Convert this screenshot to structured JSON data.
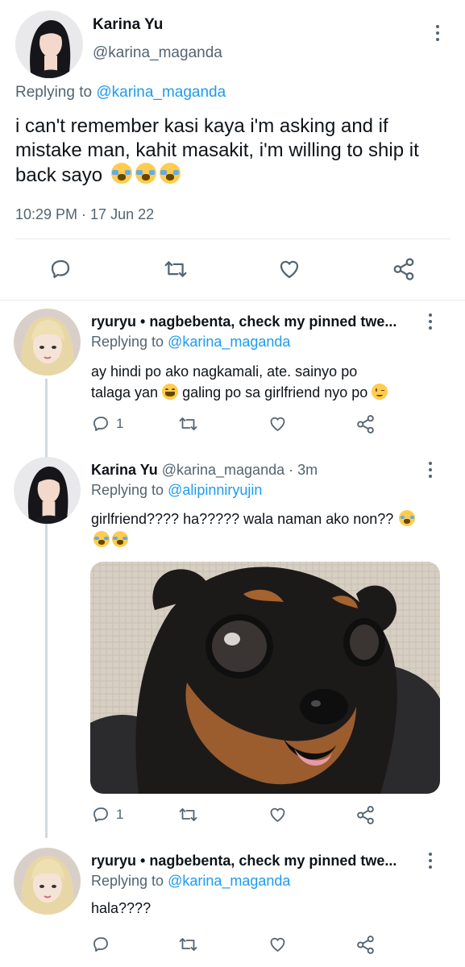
{
  "main_tweet": {
    "display_name": "Karina Yu",
    "handle": "@karina_maganda",
    "replying_prefix": "Replying to",
    "replying_handle": "@karina_maganda",
    "text": "i can't remember kasi kaya i'm asking and if mistake man, kahit masakit, i'm willing to ship it back sayo",
    "emoji": [
      "crying-face",
      "crying-face",
      "crying-face"
    ],
    "timestamp": "10:29 PM · 17 Jun 22"
  },
  "replies": [
    {
      "display_name": "ryuryu • nagbebenta, check my pinned twe...",
      "replying_prefix": "Replying to",
      "replying_handle": "@karina_maganda",
      "text_line1": "ay hindi po ako nagkamali, ate. sainyo po",
      "text_line2a": "talaga yan",
      "text_line2b": "galing po sa girlfriend nyo po",
      "reply_count": "1"
    },
    {
      "display_name": "Karina Yu",
      "handle": "@karina_maganda",
      "time": "· 3m",
      "replying_prefix": "Replying to",
      "replying_handle": "@alipinniryujin",
      "text": "girlfriend???? ha????? wala naman ako non??",
      "reply_count": "1",
      "image": "chihuahua-photo"
    },
    {
      "display_name": "ryuryu • nagbebenta, check my pinned twe...",
      "replying_prefix": "Replying to",
      "replying_handle": "@karina_maganda",
      "text": "hala????"
    }
  ],
  "colors": {
    "accent": "#1d9bf0",
    "muted": "#536471",
    "divider": "#e6ecf0",
    "text": "#0f1419"
  }
}
